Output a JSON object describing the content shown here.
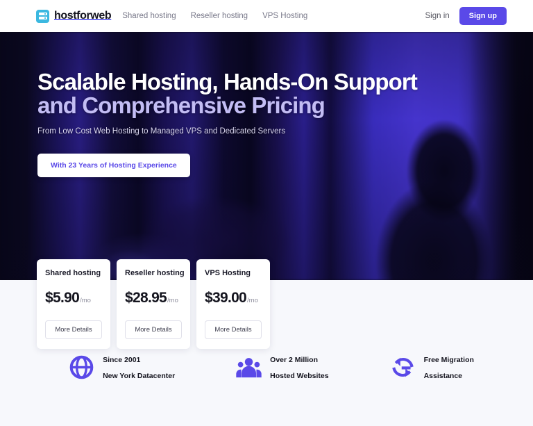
{
  "header": {
    "logo": {
      "icon": "server-icon",
      "text": "hostforweb"
    },
    "nav": [
      {
        "label": "Shared hosting"
      },
      {
        "label": "Reseller hosting"
      },
      {
        "label": "VPS Hosting"
      }
    ],
    "signin_label": "Sign in",
    "signup_label": "Sign up",
    "accent_color": "#5a49e8",
    "logo_color": "#3bb8e0"
  },
  "hero": {
    "headline_line1": "Scalable Hosting, Hands-On Support",
    "headline_line2": "and Comprehensive Pricing",
    "subtitle": "From Low Cost Web Hosting to Managed VPS and Dedicated Servers",
    "cta_label": "With 23 Years of Hosting Experience",
    "headline_line1_color": "#ffffff",
    "headline_line2_color": "#c3bdf4"
  },
  "pricing": {
    "cards": [
      {
        "title": "Shared hosting",
        "price": "$5.90",
        "period": "/mo",
        "button": "More Details"
      },
      {
        "title": "Reseller hosting",
        "price": "$28.95",
        "period": "/mo",
        "button": "More Details"
      },
      {
        "title": "VPS Hosting",
        "price": "$39.00",
        "period": "/mo",
        "button": "More Details"
      }
    ]
  },
  "features": [
    {
      "icon": "globe-icon",
      "line1": "Since 2001",
      "line2": "New York Datacenter"
    },
    {
      "icon": "people-icon",
      "line1": "Over 2 Million",
      "line2": "Hosted Websites"
    },
    {
      "icon": "sync-icon",
      "line1": "Free Migration",
      "line2": "Assistance"
    }
  ],
  "colors": {
    "page_background": "#f7f8fc",
    "brand_purple": "#5a49e8",
    "hero_dark": "#0b0a18"
  }
}
